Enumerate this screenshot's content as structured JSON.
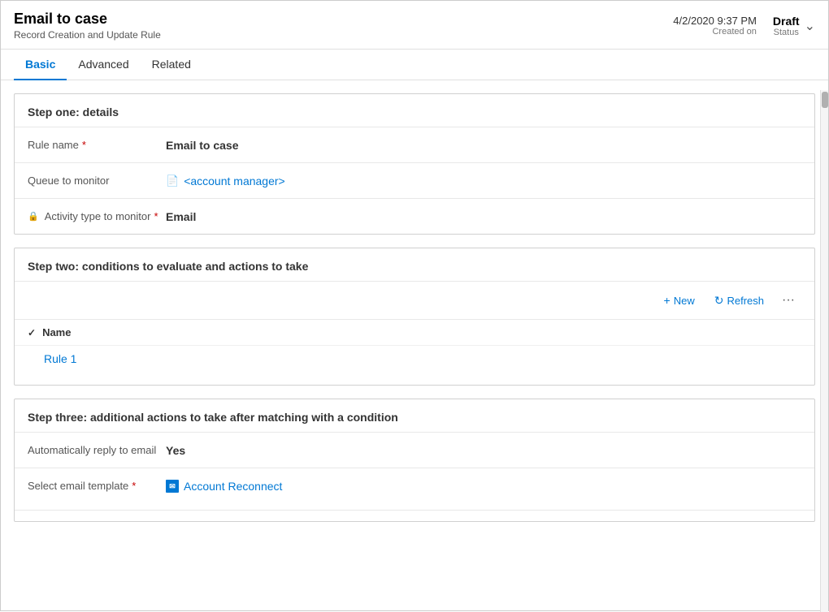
{
  "header": {
    "title": "Email to case",
    "subtitle": "Record Creation and Update Rule",
    "date": "4/2/2020 9:37 PM",
    "created_label": "Created on",
    "status": "Draft",
    "status_label": "Status"
  },
  "tabs": {
    "items": [
      {
        "id": "basic",
        "label": "Basic",
        "active": true
      },
      {
        "id": "advanced",
        "label": "Advanced",
        "active": false
      },
      {
        "id": "related",
        "label": "Related",
        "active": false
      }
    ]
  },
  "step_one": {
    "title": "Step one: details",
    "fields": {
      "rule_name": {
        "label": "Rule name",
        "required": true,
        "value": "Email to case"
      },
      "queue_to_monitor": {
        "label": "Queue to monitor",
        "required": false,
        "value": "<account manager>"
      },
      "activity_type": {
        "label": "Activity type to monitor",
        "required": true,
        "value": "Email"
      }
    }
  },
  "step_two": {
    "title": "Step two: conditions to evaluate and actions to take",
    "toolbar": {
      "new_label": "New",
      "refresh_label": "Refresh",
      "more_icon": "···"
    },
    "table": {
      "column_name": "Name",
      "rows": [
        {
          "name": "Rule 1"
        }
      ]
    }
  },
  "step_three": {
    "title": "Step three: additional actions to take after matching with a condition",
    "fields": {
      "auto_reply": {
        "label": "Automatically reply to email",
        "value": "Yes"
      },
      "email_template": {
        "label": "Select email template",
        "required": true,
        "value": "Account Reconnect"
      }
    }
  },
  "icons": {
    "lock": "🔒",
    "queue": "📄",
    "plus": "+",
    "refresh": "↻",
    "check": "✓",
    "chevron_down": "⌄",
    "ellipsis": "···"
  }
}
